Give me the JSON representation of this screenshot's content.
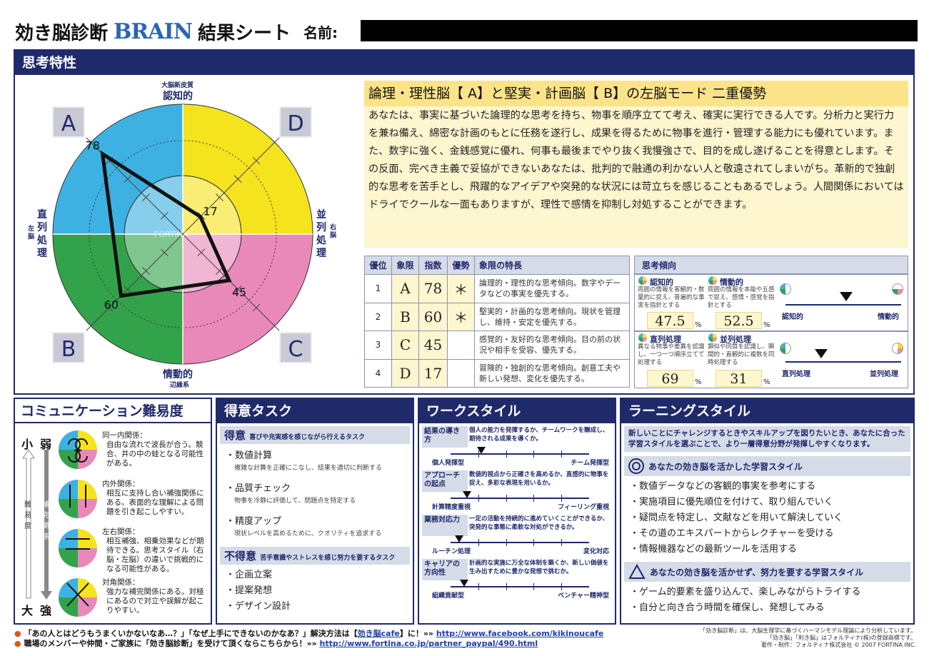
{
  "header": {
    "title_left": "効き脳診断",
    "brand": "BRAIN",
    "brand_sub": "効き脳診断",
    "title_right": "結果シート",
    "name_label": "名前:"
  },
  "thinking": {
    "section_title": "思考特性",
    "radar": {
      "top_small": "大脳新皮質",
      "top": "認知的",
      "bottom": "情動的",
      "bottom_small": "辺縁系",
      "left": "直列処理",
      "left_small": "左脳",
      "right": "並列処理",
      "right_small": "右脳",
      "quadrants": [
        "A",
        "B",
        "C",
        "D"
      ],
      "values": {
        "A": 78,
        "B": 60,
        "C": 45,
        "D": 17
      },
      "value_labels": [
        "78",
        "60",
        "45",
        "17"
      ],
      "watermark": "FORTINA",
      "colors": {
        "A": "#3eb1e3",
        "B": "#33a34b",
        "C": "#e989b9",
        "D": "#f5e31e"
      }
    },
    "type_title": "論理・理性脳【 A】と堅実・計画脳【 B】の左脳モード 二重優勢",
    "description": "あなたは、事実に基づいた論理的な思考を持ち、物事を順序立てて考え、確実に実行できる人です。分析力と実行力を兼ね備え、綿密な計画のもとに任務を遂行し、成果を得るために物事を進行・管理する能力にも優れています。また、数字に強く、金銭感覚に優れ、何事も最後までやり抜く我慢強さで、目的を成し遂げることを得意とします。その反面、完ぺき主義で妥協ができないあなたは、批判的で融通の利かない人と敬遠されてしまいがち。革新的で独創的な思考を苦手とし、飛躍的なアイデアや突発的な状況には苛立ちを感じることもあるでしょう。人間関係においてはドライでクールな一面もありますが、理性で感情を抑制し対処することができます。",
    "table": {
      "headers": [
        "優位",
        "象限",
        "指数",
        "優勢",
        "象限の特長"
      ],
      "rows": [
        {
          "rank": "1",
          "quad": "A",
          "score": "78",
          "dom": "＊",
          "feature": "論理的・理性的な思考傾向。数字やデータなどの事実を優先する。"
        },
        {
          "rank": "2",
          "quad": "B",
          "score": "60",
          "dom": "＊",
          "feature": "堅実的・計画的な思考傾向。現状を管理し、維持・安定を優先する。"
        },
        {
          "rank": "3",
          "quad": "C",
          "score": "45",
          "dom": "",
          "feature": "感覚的・友好的な思考傾向。目の前の状況や相手を受容、優先する。"
        },
        {
          "rank": "4",
          "quad": "D",
          "score": "17",
          "dom": "",
          "feature": "冒険的・独創的な思考傾向。創意工夫や新しい発想、変化を優先する。"
        }
      ]
    },
    "tendency": {
      "title": "思考傾向",
      "cognitive": {
        "label": "認知的",
        "desc": "周囲の情報を客観的・数量的に捉え、普遍的な事実を指針とする",
        "value": "47.5",
        "unit": "%"
      },
      "emotional": {
        "label": "情動的",
        "desc": "周囲の情報を本能や五感で捉え、感情・感覚を指針とする",
        "value": "52.5",
        "unit": "%"
      },
      "scale1": {
        "left": "認知的",
        "right": "情動的",
        "position": 0.525
      },
      "serial": {
        "label": "直列処理",
        "desc": "異なる物事や差異を認識し、一つ一つ順序立てて処理する",
        "value": "69",
        "unit": "%"
      },
      "parallel": {
        "label": "並列処理",
        "desc": "類似や同質を認識し、瞬間的・直観的に複数を同時処理する",
        "value": "31",
        "unit": "%"
      },
      "scale2": {
        "left": "直列処理",
        "right": "並列処理",
        "position": 0.31
      }
    }
  },
  "communication": {
    "title": "コミュニケーション難易度",
    "left_top": "小",
    "left_bottom": "大",
    "left_label": "難易度",
    "mid_top": "弱",
    "mid_bottom": "強",
    "mid_label": "補完関係",
    "items": [
      {
        "title": "同一内関係：",
        "text": "自由な流れで波長が合う。競合、井の中の蛙となる可能性がある。"
      },
      {
        "title": "内外関係：",
        "text": "相互に支持し合い補強関係にある。表面的な理解による問題を引き起こしやすい。"
      },
      {
        "title": "左右関係：",
        "text": "相互補強、相乗効果などが期待できる。思考スタイル（右脳・左脳）の違いで挑戦的になる可能性がある。"
      },
      {
        "title": "対角関係：",
        "text": "強力な補完関係にある。対極にあるので対立や誤解が起こりやすい。"
      }
    ]
  },
  "tasks": {
    "title": "得意タスク",
    "good_head": "得意",
    "good_sub": "喜びや充実感を感じながら行えるタスク",
    "good": [
      {
        "name": "・数値計算",
        "desc": "複雑な計算を正確にこなし、結果を適切に判断する"
      },
      {
        "name": "・品質チェック",
        "desc": "物事を冷静に評価して、問題点を特定する"
      },
      {
        "name": "・精度アップ",
        "desc": "現状レベルを高めるために、クオリティを追求する"
      }
    ],
    "bad_head": "不得意",
    "bad_sub": "苦手意識やストレスを感じ努力を要するタスク",
    "bad": [
      "・企画立案",
      "・提案発想",
      "・デザイン設計"
    ]
  },
  "workstyle": {
    "title": "ワークスタイル",
    "items": [
      {
        "label": "結果の導き方",
        "desc": "個人の能力を発揮するか、チームワークを醸成し、期待される成果を導くか。",
        "left": "個人発揮型",
        "right": "チーム発揮型",
        "position": 0.22
      },
      {
        "label": "アプローチの起点",
        "desc": "数値的視点から正確さを高めるか、直感的に物事を捉え、多彩な表現を用いるか。",
        "left": "計算精度重視",
        "right": "フィーリング重視",
        "position": 0.12
      },
      {
        "label": "業務対応力",
        "desc": "一定の活動を持続的に進めていくことができるか、突発的な事態に柔軟な対処ができるか。",
        "left": "ルーチン処理",
        "right": "変化対応",
        "position": 0.06
      },
      {
        "label": "キャリアの方向性",
        "desc": "計画的な実施に万全な体制を築くか、新しい価値を生み出すために豊かな発想で挑むか。",
        "left": "組織貢献型",
        "right": "ベンチャー精神型",
        "position": 0.1
      }
    ]
  },
  "learning": {
    "title": "ラーニングスタイル",
    "intro": "新しいことにチャレンジするときやスキルアップを図りたいとき、あなたに合った学習スタイルを選ぶことで、より一層得意分野が発揮しやすくなります。",
    "good_head": "あなたの効き脳を活かした学習スタイル",
    "good": [
      "・数値データなどの客観的事実を参考にする",
      "・実施項目に優先順位を付けて、取り組んでいく",
      "・疑問点を特定し、文献などを用いて解決していく",
      "・その道のエキスパートからレクチャーを受ける",
      "・情報機器などの最新ツールを活用する"
    ],
    "bad_head": "あなたの効き脳を活かせず、努力を要する学習スタイル",
    "bad": [
      "・ゲーム的要素を盛り込んで、楽しみながらトライする",
      "・自分と向き合う時間を確保し、発想してみる"
    ]
  },
  "footer": {
    "line1": "「あの人とはどうもうまくいかないなあ…？」「なぜ上手にできないのかなあ？」解決方法は【",
    "line1_link_text": "効き脳cafe",
    "line1_mid": "】に！»» ",
    "line1_url": "http://www.facebook.com/kikinoucafe",
    "line2": "職場のメンバーや仲間・ご家族に「効き脳診断」を受けて頂くならこちらから！»» ",
    "line2_url": "http://www.fortina.co.jp/partner_paypal/490.html",
    "note1": "「効き脳診断」は、大脳生理学に基づくハーマンモデル理論により分析しています。",
    "note2": "「効き脳」「利き脳」はフォルティナ(株)の登録商標です。",
    "note3": "著作・制作：フォルティナ株式会社 © 2007 FORTINA INC."
  }
}
